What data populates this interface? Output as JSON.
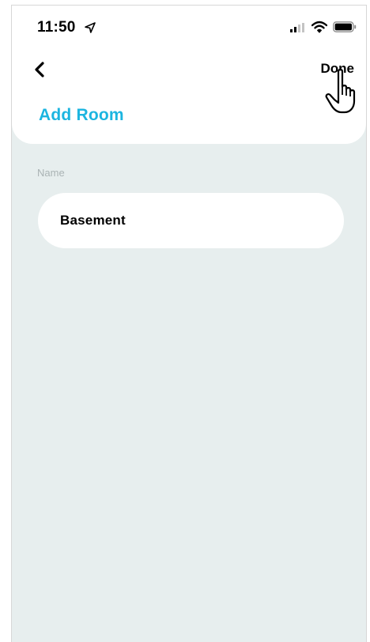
{
  "status_bar": {
    "time": "11:50",
    "icons": [
      "location-arrow-icon",
      "signal-icon",
      "wifi-icon",
      "battery-icon"
    ]
  },
  "nav": {
    "back_icon": "chevron-left-icon",
    "done_label": "Done"
  },
  "page": {
    "title": "Add Room",
    "title_color": "#1cb5e0"
  },
  "form": {
    "name_label": "Name",
    "name_value": "Basement"
  },
  "colors": {
    "background": "#e7eeee",
    "sheet": "#ffffff",
    "accent": "#1cb5e0"
  }
}
